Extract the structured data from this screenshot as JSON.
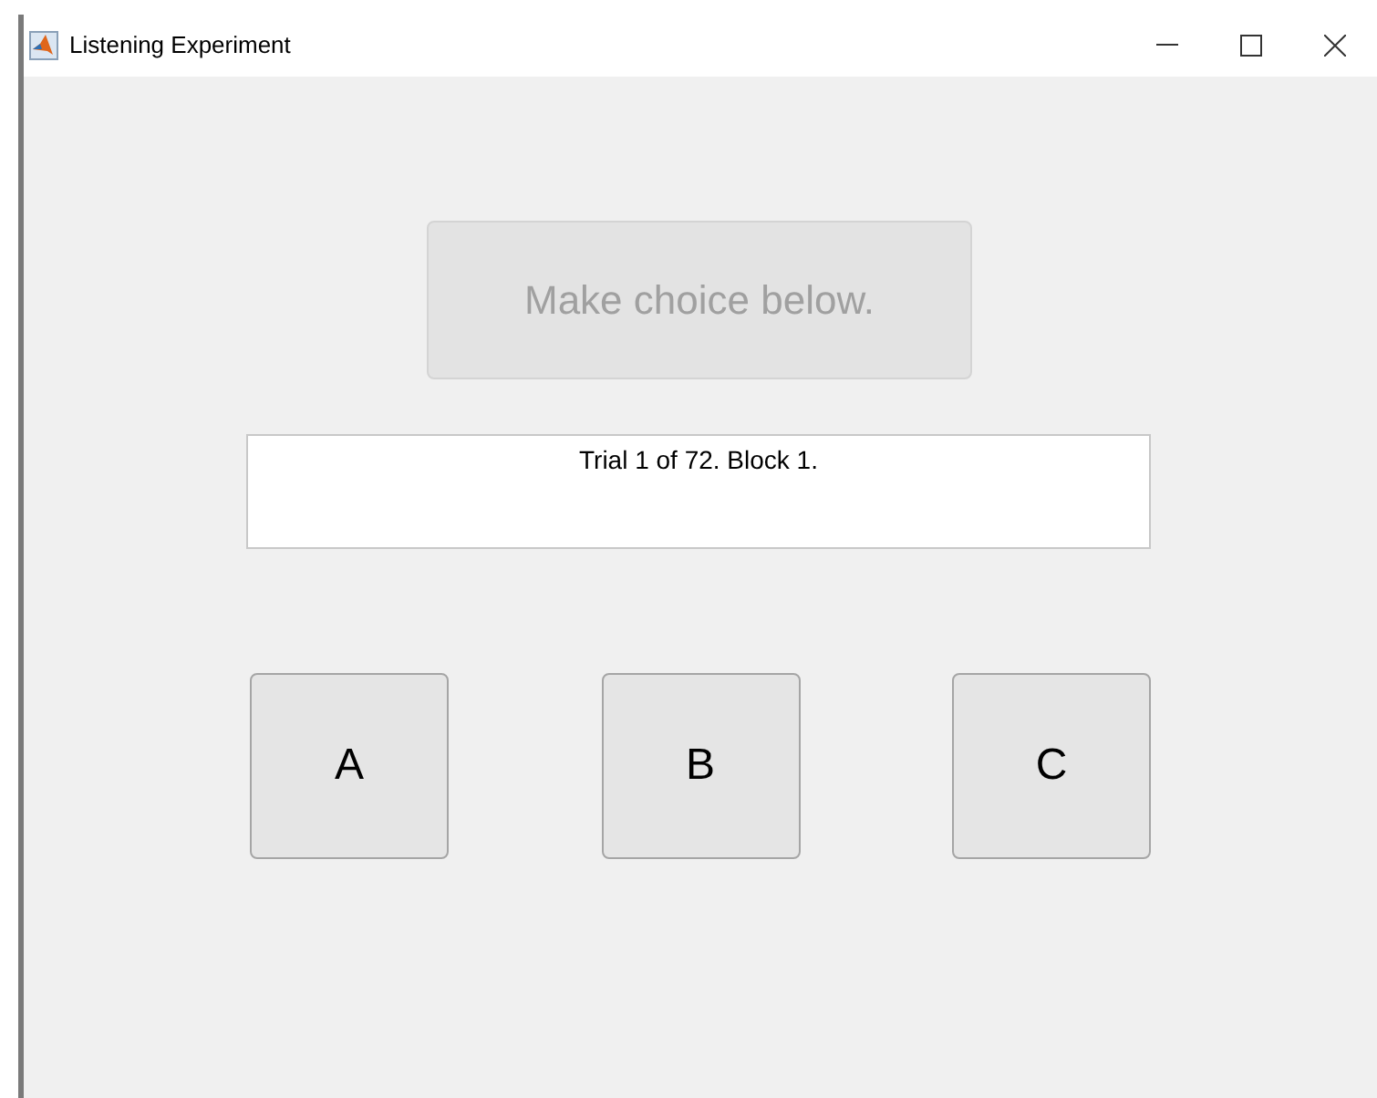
{
  "window": {
    "title": "Listening Experiment"
  },
  "prompt_button": {
    "label": "Make choice below.",
    "disabled": true
  },
  "status_text": "Trial 1 of 72. Block 1.",
  "choices": [
    {
      "label": "A",
      "disabled": false
    },
    {
      "label": "B",
      "disabled": false
    },
    {
      "label": "C",
      "disabled": false
    }
  ]
}
